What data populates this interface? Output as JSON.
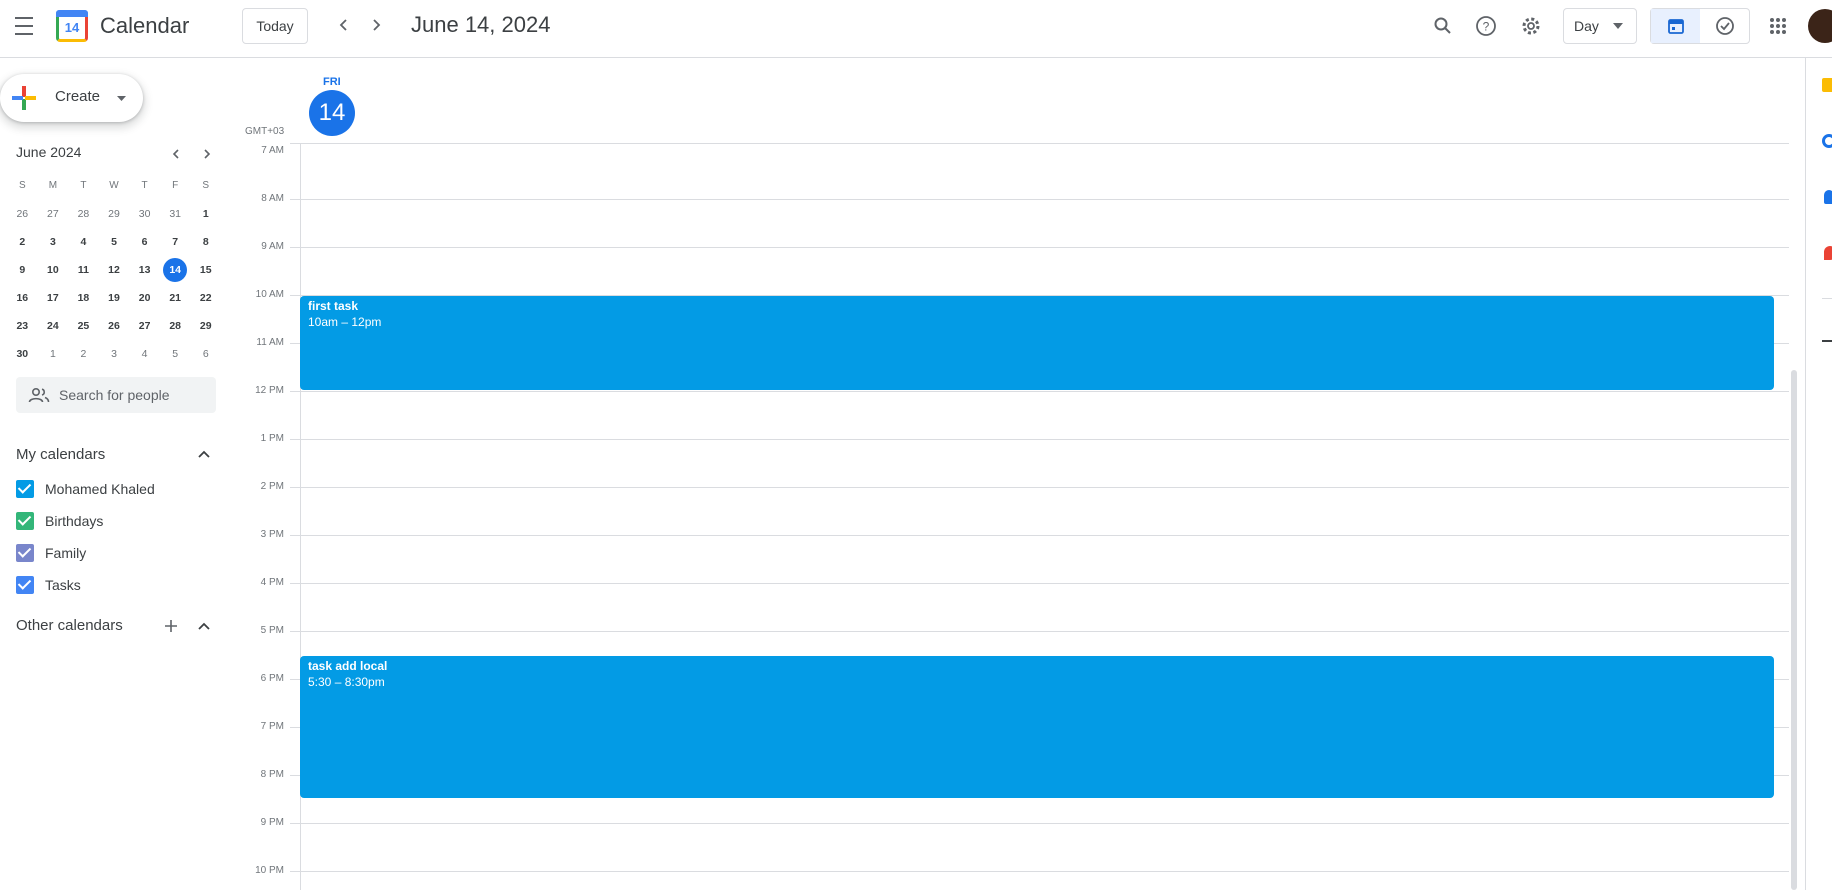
{
  "header": {
    "app_title": "Calendar",
    "logo_day": "14",
    "today_label": "Today",
    "date_title": "June 14, 2024",
    "view_label": "Day"
  },
  "sidebar": {
    "create_label": "Create",
    "mini_month_title": "June 2024",
    "weekdays": [
      "S",
      "M",
      "T",
      "W",
      "T",
      "F",
      "S"
    ],
    "weeks": [
      [
        "26",
        "27",
        "28",
        "29",
        "30",
        "31",
        "1"
      ],
      [
        "2",
        "3",
        "4",
        "5",
        "6",
        "7",
        "8"
      ],
      [
        "9",
        "10",
        "11",
        "12",
        "13",
        "14",
        "15"
      ],
      [
        "16",
        "17",
        "18",
        "19",
        "20",
        "21",
        "22"
      ],
      [
        "23",
        "24",
        "25",
        "26",
        "27",
        "28",
        "29"
      ],
      [
        "30",
        "1",
        "2",
        "3",
        "4",
        "5",
        "6"
      ]
    ],
    "people_search_placeholder": "Search for people",
    "my_calendars_title": "My calendars",
    "my_calendars": [
      {
        "label": "Mohamed Khaled",
        "color": "#039be5"
      },
      {
        "label": "Birthdays",
        "color": "#33b679"
      },
      {
        "label": "Family",
        "color": "#7986cb"
      },
      {
        "label": "Tasks",
        "color": "#4285f4"
      }
    ],
    "other_calendars_title": "Other calendars"
  },
  "main": {
    "day_of_week": "FRI",
    "day_number": "14",
    "timezone": "GMT+03",
    "hours": [
      "7 AM",
      "8 AM",
      "9 AM",
      "10 AM",
      "11 AM",
      "12 PM",
      "1 PM",
      "2 PM",
      "3 PM",
      "4 PM",
      "5 PM",
      "6 PM",
      "7 PM",
      "8 PM",
      "9 PM",
      "10 PM"
    ],
    "events": [
      {
        "title": "first task",
        "time": "10am – 12pm"
      },
      {
        "title": "task add local",
        "time": "5:30 – 8:30pm"
      }
    ]
  },
  "colors": {
    "accent": "#1a73e8",
    "event": "#039be5"
  }
}
